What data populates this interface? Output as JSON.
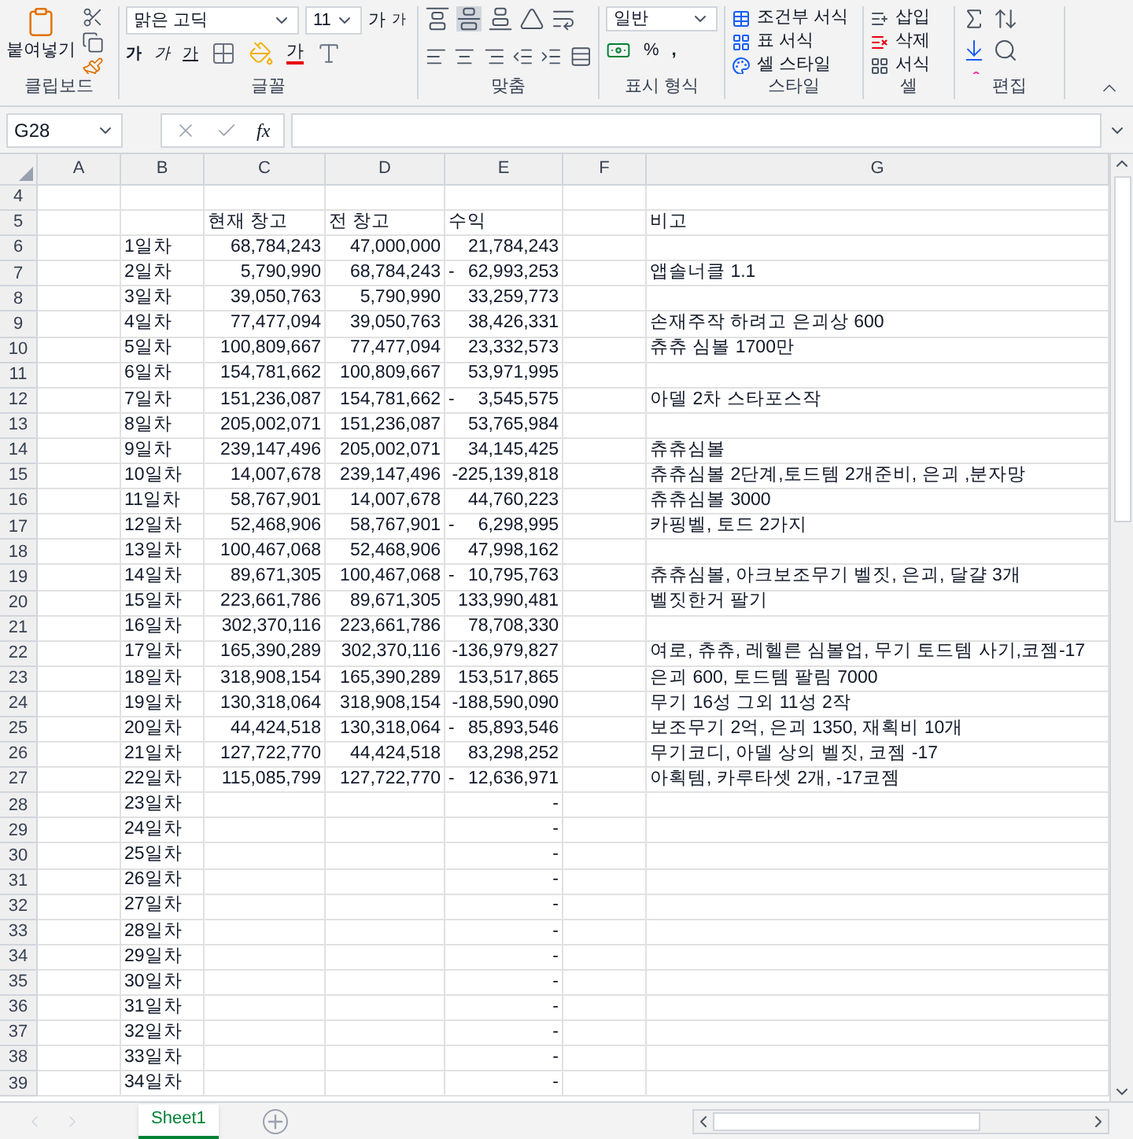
{
  "clipboard": {
    "paste_label": "붙여넣기",
    "group_label": "클립보드"
  },
  "font": {
    "name": "맑은 고딕",
    "size": "11",
    "grow": "가",
    "shrink": "가",
    "bold": "가",
    "italic": "가",
    "underline": "가",
    "font_color": "가",
    "group_label": "글꼴"
  },
  "alignment": {
    "group_label": "맞춤"
  },
  "number": {
    "format": "일반",
    "percent": "%",
    "comma": ",",
    "group_label": "표시 형식"
  },
  "styles": {
    "items": [
      "조건부 서식",
      "표 서식",
      "셀 스타일"
    ],
    "group_label": "스타일"
  },
  "cells": {
    "items": [
      "삽입",
      "삭제",
      "서식"
    ],
    "group_label": "셀"
  },
  "editing": {
    "group_label": "편집"
  },
  "formula_bar": {
    "name_box": "G28",
    "fx": "fx"
  },
  "columns": [
    "A",
    "B",
    "C",
    "D",
    "E",
    "F",
    "G"
  ],
  "rows": [
    {
      "num": "4",
      "kind": "data"
    },
    {
      "num": "5",
      "kind": "header",
      "c": "현재 창고",
      "d": "전 창고",
      "e": "수익",
      "g": "비고"
    },
    {
      "num": "6",
      "kind": "data",
      "b": "1일차",
      "c": "68,784,243",
      "d": "47,000,000",
      "e": "21,784,243"
    },
    {
      "num": "7",
      "kind": "data",
      "b": "2일차",
      "c": "5,790,990",
      "d": "68,784,243",
      "e_sign": "-",
      "e": "62,993,253",
      "g": "앱솔너클 1.1"
    },
    {
      "num": "8",
      "kind": "data",
      "b": "3일차",
      "c": "39,050,763",
      "d": "5,790,990",
      "e": "33,259,773"
    },
    {
      "num": "9",
      "kind": "data",
      "b": "4일차",
      "c": "77,477,094",
      "d": "39,050,763",
      "e": "38,426,331",
      "g": "손재주작 하려고 은괴상 600"
    },
    {
      "num": "10",
      "kind": "data",
      "b": "5일차",
      "c": "100,809,667",
      "d": "77,477,094",
      "e": "23,332,573",
      "g": "츄츄 심볼 1700만"
    },
    {
      "num": "11",
      "kind": "data",
      "b": "6일차",
      "c": "154,781,662",
      "d": "100,809,667",
      "e": "53,971,995"
    },
    {
      "num": "12",
      "kind": "data",
      "b": "7일차",
      "c": "151,236,087",
      "d": "154,781,662",
      "e_sign": "-",
      "e": "3,545,575",
      "g": "아델 2차 스타포스작"
    },
    {
      "num": "13",
      "kind": "data",
      "b": "8일차",
      "c": "205,002,071",
      "d": "151,236,087",
      "e": "53,765,984"
    },
    {
      "num": "14",
      "kind": "data",
      "b": "9일차",
      "c": "239,147,496",
      "d": "205,002,071",
      "e": "34,145,425",
      "g": "츄츄심볼"
    },
    {
      "num": "15",
      "kind": "data",
      "b": "10일차",
      "c": "14,007,678",
      "d": "239,147,496",
      "e": "-225,139,818",
      "g": "츄츄심볼 2단계,토드템 2개준비, 은괴 ,분자망"
    },
    {
      "num": "16",
      "kind": "data",
      "b": "11일차",
      "c": "58,767,901",
      "d": "14,007,678",
      "e": "44,760,223",
      "g": "츄츄심볼 3000"
    },
    {
      "num": "17",
      "kind": "data",
      "b": "12일차",
      "c": "52,468,906",
      "d": "58,767,901",
      "e_sign": "-",
      "e": "6,298,995",
      "g": "카핑벨, 토드 2가지"
    },
    {
      "num": "18",
      "kind": "data",
      "b": "13일차",
      "c": "100,467,068",
      "d": "52,468,906",
      "e": "47,998,162"
    },
    {
      "num": "19",
      "kind": "data",
      "b": "14일차",
      "c": "89,671,305",
      "d": "100,467,068",
      "e_sign": "-",
      "e": "10,795,763",
      "g": "츄츄심볼, 아크보조무기 벨짓, 은괴, 달걀 3개"
    },
    {
      "num": "20",
      "kind": "data",
      "b": "15일차",
      "c": "223,661,786",
      "d": "89,671,305",
      "e": "133,990,481",
      "g": "벨짓한거 팔기"
    },
    {
      "num": "21",
      "kind": "data",
      "b": "16일차",
      "c": "302,370,116",
      "d": "223,661,786",
      "e": "78,708,330"
    },
    {
      "num": "22",
      "kind": "data",
      "b": "17일차",
      "c": "165,390,289",
      "d": "302,370,116",
      "e": "-136,979,827",
      "g": "여로, 츄츄, 레헬른 심볼업, 무기 토드템 사기,코젬-17"
    },
    {
      "num": "23",
      "kind": "data",
      "b": "18일차",
      "c": "318,908,154",
      "d": "165,390,289",
      "e": "153,517,865",
      "g": "은괴 600, 토드템 팔림 7000"
    },
    {
      "num": "24",
      "kind": "data",
      "b": "19일차",
      "c": "130,318,064",
      "d": "318,908,154",
      "e": "-188,590,090",
      "g": "무기 16성 그외 11성 2작"
    },
    {
      "num": "25",
      "kind": "data",
      "b": "20일차",
      "c": "44,424,518",
      "d": "130,318,064",
      "e_sign": "-",
      "e": "85,893,546",
      "g": "보조무기 2억, 은괴 1350, 재획비 10개"
    },
    {
      "num": "26",
      "kind": "data",
      "b": "21일차",
      "c": "127,722,770",
      "d": "44,424,518",
      "e": "83,298,252",
      "g": "무기코디, 아델 상의 벨짓, 코젬 -17"
    },
    {
      "num": "27",
      "kind": "data",
      "b": "22일차",
      "c": "115,085,799",
      "d": "127,722,770",
      "e_sign": "-",
      "e": "12,636,971",
      "g": "아획템, 카루타셋 2개, -17코젬"
    },
    {
      "num": "28",
      "kind": "data",
      "b": "23일차",
      "e": "-"
    },
    {
      "num": "29",
      "kind": "data",
      "b": "24일차",
      "e": "-"
    },
    {
      "num": "30",
      "kind": "data",
      "b": "25일차",
      "e": "-"
    },
    {
      "num": "31",
      "kind": "data",
      "b": "26일차",
      "e": "-"
    },
    {
      "num": "32",
      "kind": "data",
      "b": "27일차",
      "e": "-"
    },
    {
      "num": "33",
      "kind": "data",
      "b": "28일차",
      "e": "-"
    },
    {
      "num": "34",
      "kind": "data",
      "b": "29일차",
      "e": "-"
    },
    {
      "num": "35",
      "kind": "data",
      "b": "30일차",
      "e": "-"
    },
    {
      "num": "36",
      "kind": "data",
      "b": "31일차",
      "e": "-"
    },
    {
      "num": "37",
      "kind": "data",
      "b": "32일차",
      "e": "-"
    },
    {
      "num": "38",
      "kind": "data",
      "b": "33일차",
      "e": "-"
    },
    {
      "num": "39",
      "kind": "data",
      "b": "34일차",
      "e": "-"
    }
  ],
  "sheet_tabs": [
    {
      "label": "Sheet1",
      "selected": true
    }
  ]
}
